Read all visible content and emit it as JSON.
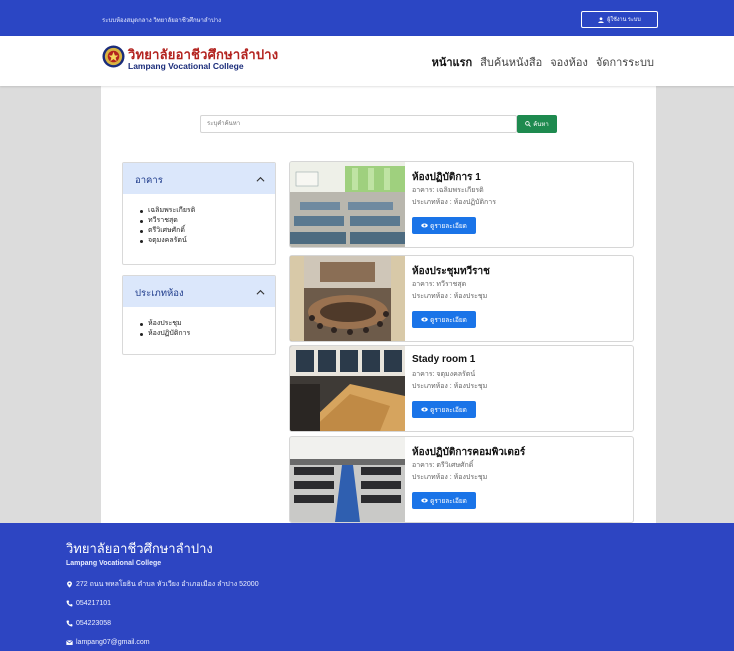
{
  "topbar": {
    "site_name": "ระบบห้องสมุดกลาง วิทยาลัยอาชีวศึกษาลำปาง",
    "user_button": "ผู้ใช้งาน ระบบ",
    "user_icon": "user-icon"
  },
  "header": {
    "logo_th": "วิทยาลัยอาชีวศึกษาลำปาง",
    "logo_en": "Lampang Vocational College",
    "nav": [
      "หน้าแรก",
      "สืบค้นหนังสือ",
      "จองห้อง",
      "จัดการระบบ"
    ]
  },
  "search": {
    "placeholder": "ระบุคำค้นหา",
    "button_label": "ค้นหา",
    "button_icon": "search-icon"
  },
  "filters": [
    {
      "title": "อาคาร",
      "items": [
        "เฉลิมพระเกียรติ",
        "ทวีราชสุด",
        "ตรีวิเศษศักดิ์",
        "จตุมงคลรัตน์"
      ]
    },
    {
      "title": "ประเภทห้อง",
      "items": [
        "ห้องประชุม",
        "ห้องปฏิบัติการ"
      ]
    }
  ],
  "rooms": [
    {
      "title": "ห้องปฏิบัติการ 1",
      "building": "อาคาร: เฉลิมพระเกียรติ",
      "type": "ประเภทห้อง : ห้องปฏิบัติการ",
      "button": "ดูรายละเอียด"
    },
    {
      "title": "ห้องประชุมทวีราช",
      "building": "อาคาร: ทวีราชสุด",
      "type": "ประเภทห้อง : ห้องประชุม",
      "button": "ดูรายละเอียด"
    },
    {
      "title": "Stady room 1",
      "building": "อาคาร: จตุมงคลรัตน์",
      "type": "ประเภทห้อง : ห้องประชุม",
      "button": "ดูรายละเอียด"
    },
    {
      "title": "ห้องปฏิบัติการคอมพิวเตอร์",
      "building": "อาคาร: ตรีวิเศษศักดิ์",
      "type": "ประเภทห้อง : ห้องประชุม",
      "button": "ดูรายละเอียด"
    }
  ],
  "footer": {
    "name": "วิทยาลัยอาชีวศึกษาลำปาง",
    "name_en": "Lampang Vocational College",
    "address": "272 ถนน พหลโยธิน ตำบล หัวเวียง อำเภอเมือง ลำปาง 52000",
    "phone1": "054217101",
    "phone2": "054223058",
    "email": "lampang07@gmail.com"
  },
  "colors": {
    "brand_blue": "#2b46c4",
    "search_green": "#1e8a4f",
    "detail_blue": "#1a74e8",
    "filter_header": "#dbe7fb"
  }
}
